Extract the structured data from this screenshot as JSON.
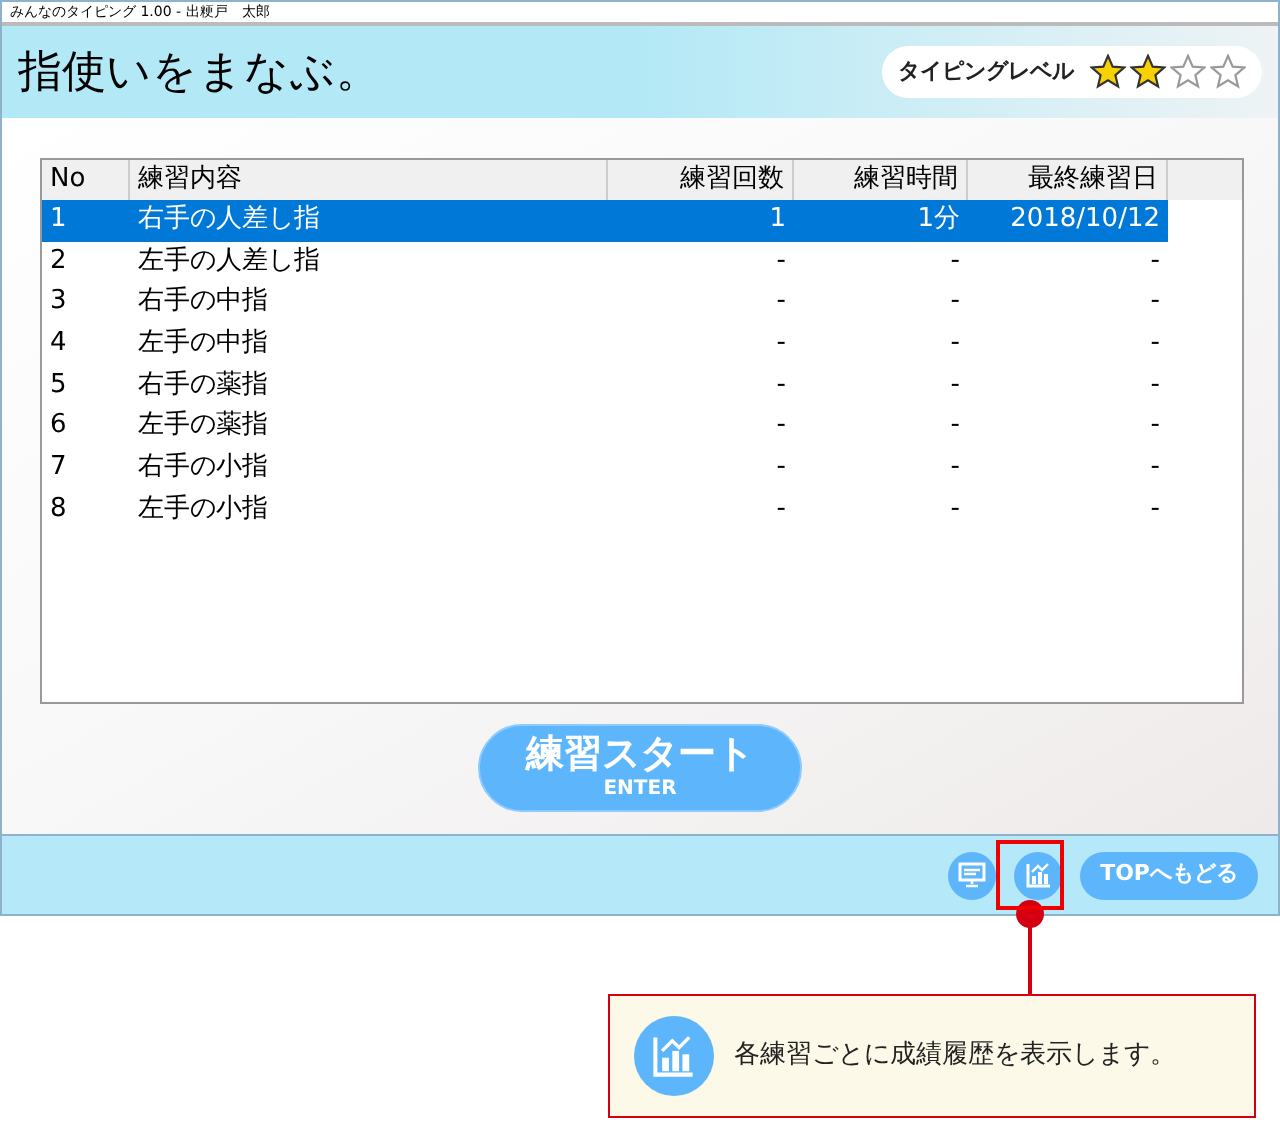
{
  "window": {
    "title": "みんなのタイピング 1.00 - 出粳戸　太郎"
  },
  "header": {
    "title": "指使いをまなぶ。",
    "typing_level": {
      "label": "タイピングレベル",
      "stars": 2
    }
  },
  "table": {
    "columns": [
      "No",
      "練習内容",
      "練習回数",
      "練習時間",
      "最終練習日"
    ],
    "rows": [
      {
        "cells": [
          "1",
          "右手の人差し指",
          "1",
          "1分",
          "2018/10/12"
        ],
        "selected": true
      },
      {
        "cells": [
          "2",
          "左手の人差し指",
          "-",
          "-",
          "-"
        ],
        "selected": false
      },
      {
        "cells": [
          "3",
          "右手の中指",
          "-",
          "-",
          "-"
        ],
        "selected": false
      },
      {
        "cells": [
          "4",
          "左手の中指",
          "-",
          "-",
          "-"
        ],
        "selected": false
      },
      {
        "cells": [
          "5",
          "右手の薬指",
          "-",
          "-",
          "-"
        ],
        "selected": false
      },
      {
        "cells": [
          "6",
          "左手の薬指",
          "-",
          "-",
          "-"
        ],
        "selected": false
      },
      {
        "cells": [
          "7",
          "右手の小指",
          "-",
          "-",
          "-"
        ],
        "selected": false
      },
      {
        "cells": [
          "8",
          "左手の小指",
          "-",
          "-",
          "-"
        ],
        "selected": false
      }
    ]
  },
  "start_button": {
    "label": "練習スタート",
    "sublabel": "ENTER"
  },
  "footer": {
    "top_button": "TOPへもどる"
  },
  "callout": {
    "text": "各練習ごとに成績履歴を表示します。"
  }
}
